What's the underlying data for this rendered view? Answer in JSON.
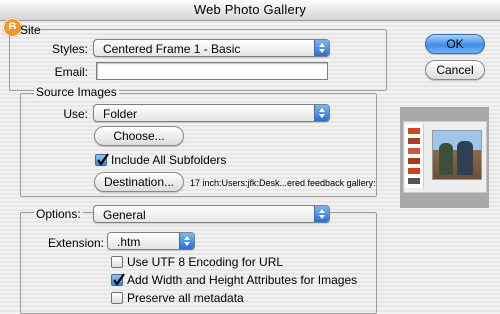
{
  "window": {
    "title": "Web Photo Gallery",
    "badge": "B"
  },
  "site": {
    "group_title": "Site",
    "styles_label": "Styles:",
    "styles_value": "Centered Frame 1 - Basic",
    "email_label": "Email:",
    "email_value": ""
  },
  "source": {
    "group_title": "Source Images",
    "use_label": "Use:",
    "use_value": "Folder",
    "choose_label": "Choose...",
    "include_subfolders_label": "Include All Subfolders",
    "include_subfolders_checked": true,
    "destination_label": "Destination...",
    "destination_path": "17 inch:Users:jfk:Desk...ered feedback gallery:"
  },
  "options": {
    "group_title": "Options:",
    "options_value": "General",
    "extension_label": "Extension:",
    "extension_value": ".htm",
    "checkboxes": [
      {
        "label": "Use UTF 8 Encoding for URL",
        "checked": false
      },
      {
        "label": "Add Width and Height Attributes for Images",
        "checked": true
      },
      {
        "label": "Preserve all metadata",
        "checked": false
      }
    ]
  },
  "buttons": {
    "ok": "OK",
    "cancel": "Cancel"
  },
  "colors": {
    "badge": "#f39a1c",
    "aqua_blue": "#3f8fe6"
  }
}
